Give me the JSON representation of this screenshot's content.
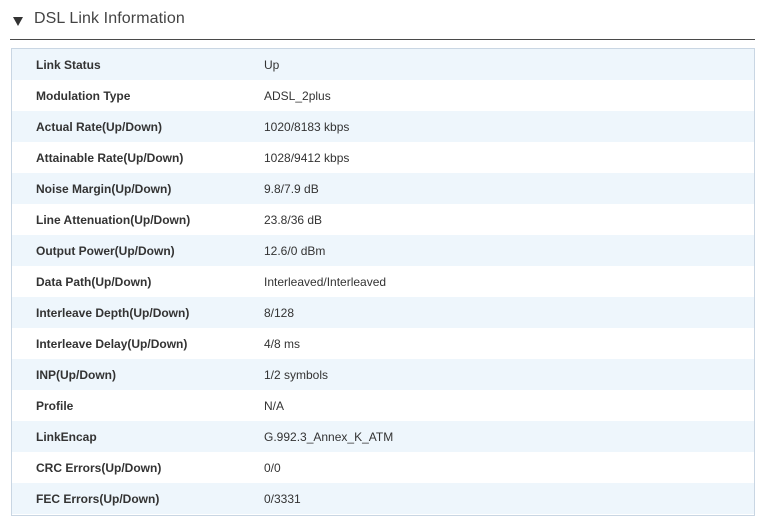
{
  "section": {
    "title": "DSL Link Information",
    "collapse_icon": "triangle-down-icon"
  },
  "rows": [
    {
      "label": "Link Status",
      "value": "Up"
    },
    {
      "label": "Modulation Type",
      "value": "ADSL_2plus"
    },
    {
      "label": "Actual Rate(Up/Down)",
      "value": "1020/8183 kbps"
    },
    {
      "label": "Attainable Rate(Up/Down)",
      "value": "1028/9412 kbps"
    },
    {
      "label": "Noise Margin(Up/Down)",
      "value": "9.8/7.9 dB"
    },
    {
      "label": "Line Attenuation(Up/Down)",
      "value": "23.8/36 dB"
    },
    {
      "label": "Output Power(Up/Down)",
      "value": "12.6/0 dBm"
    },
    {
      "label": "Data Path(Up/Down)",
      "value": "Interleaved/Interleaved"
    },
    {
      "label": "Interleave Depth(Up/Down)",
      "value": "8/128"
    },
    {
      "label": "Interleave Delay(Up/Down)",
      "value": "4/8 ms"
    },
    {
      "label": "INP(Up/Down)",
      "value": "1/2 symbols"
    },
    {
      "label": "Profile",
      "value": "N/A"
    },
    {
      "label": "LinkEncap",
      "value": "G.992.3_Annex_K_ATM"
    },
    {
      "label": "CRC Errors(Up/Down)",
      "value": "0/0"
    },
    {
      "label": "FEC Errors(Up/Down)",
      "value": "0/3331"
    }
  ],
  "colors": {
    "row_stripe": "#eef6fc",
    "table_border": "#c9d6e3",
    "header_rule": "#4a4a4a",
    "text": "#333333"
  }
}
